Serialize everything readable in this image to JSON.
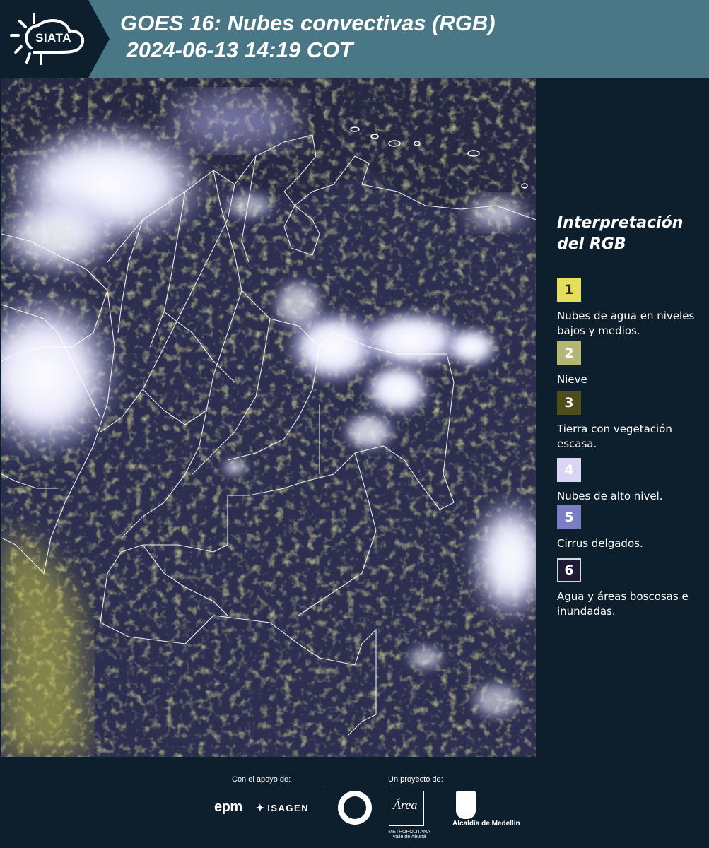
{
  "header": {
    "logo_text": "SIATA",
    "title_line1": "GOES 16: Nubes convectivas (RGB)",
    "title_line2": " 2024-06-13 14:19 COT"
  },
  "map": {
    "description_icon": "satellite-rgb-image"
  },
  "legend": {
    "title_line1": "Interpretación",
    "title_line2": "del RGB",
    "items": [
      {
        "number": "1",
        "label": "Nubes de agua en niveles bajos y medios.",
        "color": "#e3df5c",
        "text_color": "#2a2a10",
        "border": "none"
      },
      {
        "number": "2",
        "label": "Nieve",
        "color": "#b5b676",
        "text_color": "#ffffff",
        "border": "none"
      },
      {
        "number": "3",
        "label": "Tierra con vegetación escasa.",
        "color": "#4d4d1c",
        "text_color": "#ffffff",
        "border": "none"
      },
      {
        "number": "4",
        "label": "Nubes de alto nivel.",
        "color": "#d8d6f3",
        "text_color": "#ffffff",
        "border": "none"
      },
      {
        "number": "5",
        "label": "Cirrus delgados.",
        "color": "#7c7ec4",
        "text_color": "#ffffff",
        "border": "none"
      },
      {
        "number": "6",
        "label": "Agua y áreas boscosas e inundadas.",
        "color": "#1e1a33",
        "text_color": "#ffffff",
        "border": "#cfd8dc"
      }
    ]
  },
  "footer": {
    "support_label": "Con el apoyo de:",
    "project_label": "Un proyecto de:",
    "epm": "epm",
    "isagen": "ISAGEN",
    "area_word": "Área",
    "area_sub": "METROPOLITANA Valle de Aburrá",
    "alcaldia": "Alcaldía de Medellín"
  }
}
